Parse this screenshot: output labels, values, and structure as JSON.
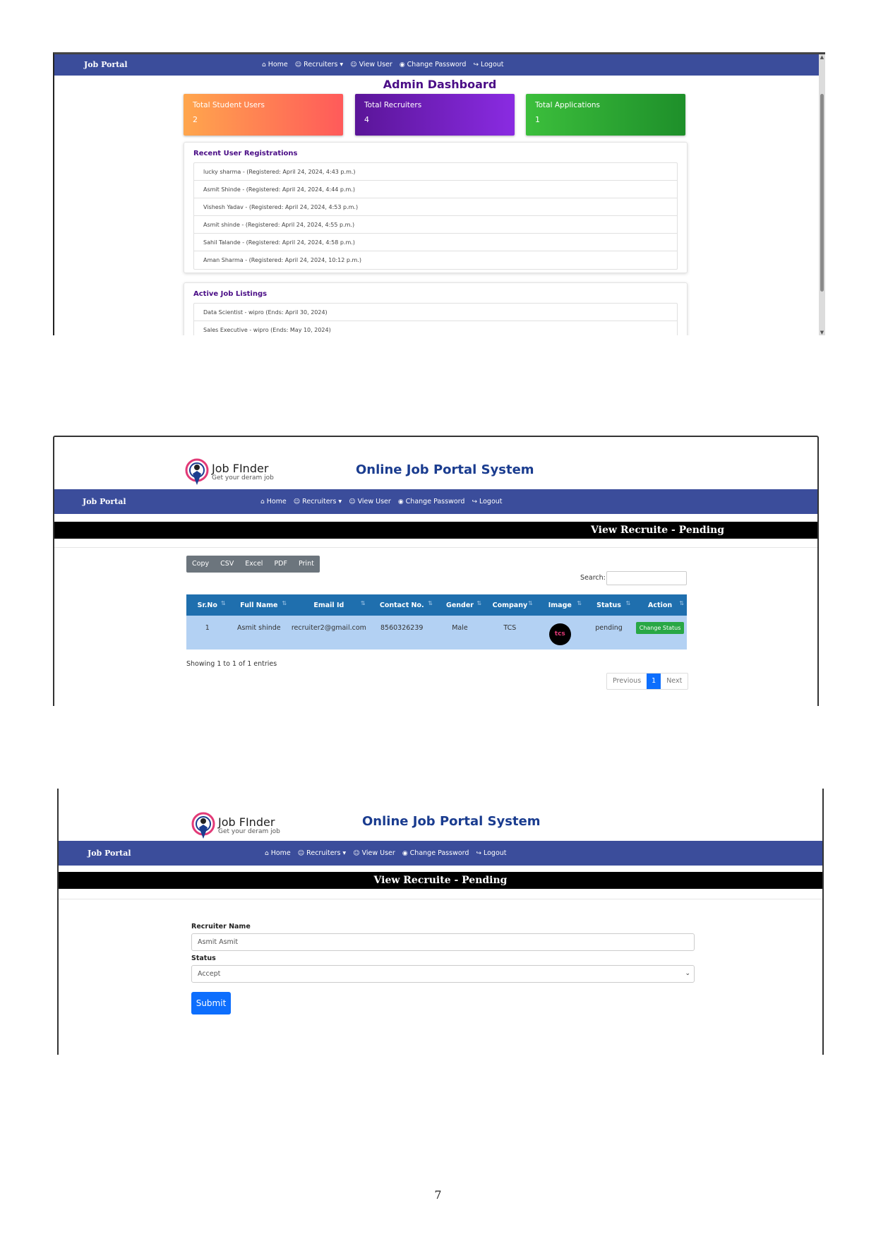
{
  "nav": {
    "brand": "Job Portal",
    "items": [
      {
        "icon": "home-icon",
        "glyph": "⌂",
        "label": "Home"
      },
      {
        "icon": "users-icon",
        "glyph": "☺",
        "label": "Recruiters ▾"
      },
      {
        "icon": "user-icon",
        "glyph": "☺",
        "label": "View User"
      },
      {
        "icon": "user-circle-icon",
        "glyph": "◉",
        "label": "Change Password"
      },
      {
        "icon": "logout-icon",
        "glyph": "↪",
        "label": "Logout"
      }
    ]
  },
  "dashboard": {
    "title": "Admin Dashboard",
    "stats": [
      {
        "label": "Total Student Users",
        "value": "2"
      },
      {
        "label": "Total Recruiters",
        "value": "4"
      },
      {
        "label": "Total Applications",
        "value": "1"
      }
    ],
    "recent_title": "Recent User Registrations",
    "recent": [
      "lucky sharma - (Registered: April 24, 2024, 4:43 p.m.)",
      "Asmit Shinde - (Registered: April 24, 2024, 4:44 p.m.)",
      "Vishesh Yadav - (Registered: April 24, 2024, 4:53 p.m.)",
      "Asmit shinde - (Registered: April 24, 2024, 4:55 p.m.)",
      "Sahil Talande - (Registered: April 24, 2024, 4:58 p.m.)",
      "Aman Sharma - (Registered: April 24, 2024, 10:12 p.m.)"
    ],
    "jobs_title": "Active Job Listings",
    "jobs": [
      "Data Scientist - wipro (Ends: April 30, 2024)",
      "Sales Executive - wipro (Ends: May 10, 2024)"
    ]
  },
  "header": {
    "logo_name": "Job FInder",
    "logo_tag": "Get your deram job",
    "site_title": "Online Job Portal System"
  },
  "list_view": {
    "page_title": "View Recruite - Pending",
    "buttons": [
      "Copy",
      "CSV",
      "Excel",
      "PDF",
      "Print"
    ],
    "search_label": "Search:",
    "columns": [
      "Sr.No",
      "Full Name",
      "Email Id",
      "Contact No.",
      "Gender",
      "Company",
      "Image",
      "Status",
      "Action"
    ],
    "rows": [
      {
        "srno": "1",
        "name": "Asmit shinde",
        "email": "recruiter2@gmail.com",
        "contact": "8560326239",
        "gender": "Male",
        "company": "TCS",
        "image_text": "tcs",
        "status": "pending",
        "action": "Change Status"
      }
    ],
    "showing": "Showing 1 to 1 of 1 entries",
    "pager": {
      "prev": "Previous",
      "current": "1",
      "next": "Next"
    }
  },
  "form_view": {
    "page_title": "View Recruite - Pending",
    "name_label": "Recruiter Name",
    "name_value": "Asmit Asmit",
    "status_label": "Status",
    "status_value": "Accept",
    "submit": "Submit"
  },
  "page_number": "7",
  "colors": {
    "navbar": "#3b4d9b",
    "dash_title": "#4a0d86",
    "stat1": "#ff9a4d",
    "stat2": "#6a1bb0",
    "stat3": "#2eaa3c",
    "table_header": "#1f6fae",
    "table_row": "#b3d1f3",
    "primary": "#0d6efd",
    "success": "#28a745"
  }
}
